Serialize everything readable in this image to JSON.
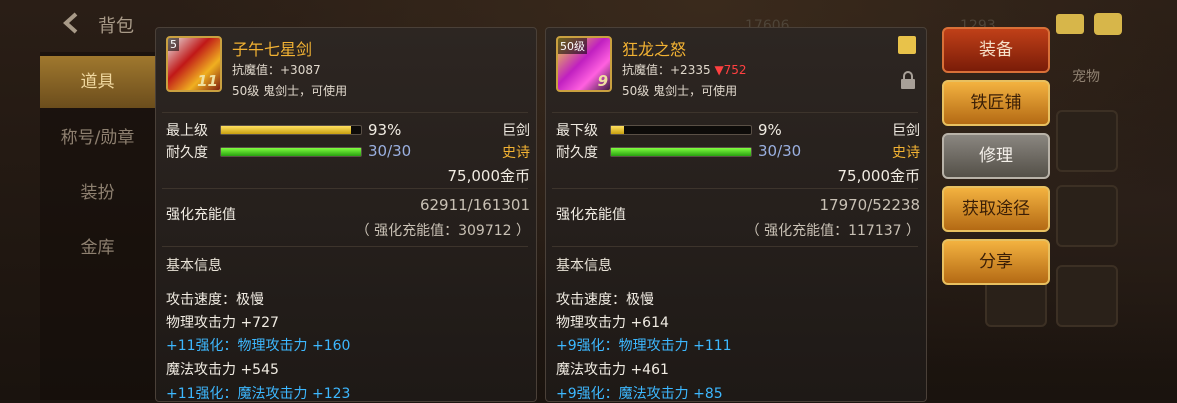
{
  "header": {
    "title": "背包",
    "faded_a": "17606",
    "faded_b": "1293"
  },
  "sidebar": {
    "items": [
      {
        "label": "道具"
      },
      {
        "label": "称号/勋章"
      },
      {
        "label": "装扮"
      },
      {
        "label": "金库"
      }
    ]
  },
  "inventory": {
    "label": "宠物"
  },
  "left_item": {
    "level_badge": "5",
    "enhance_badge": "11",
    "name": "子午七星剑",
    "anti_magic": "抗魔值：+3087",
    "usable": "50级 鬼剑士，可使用",
    "grade_label": "最上级",
    "grade_pct": "93%",
    "grade_fill": 93,
    "durability_label": "耐久度",
    "durability_value": "30/30",
    "durability_fill": 100,
    "weapon_type": "巨剑",
    "rarity": "史诗",
    "price": "75,000金币",
    "enhance_label": "强化充能值",
    "enhance_value": "62911/161301",
    "enhance_total": "（ 强化充能值：309712 ）",
    "section": "基本信息",
    "stats": [
      {
        "text": "攻击速度：极慢",
        "blue": false
      },
      {
        "text": "物理攻击力 +727",
        "blue": false
      },
      {
        "text": "+11强化：物理攻击力 +160",
        "blue": true
      },
      {
        "text": "魔法攻击力 +545",
        "blue": false
      },
      {
        "text": "+11强化：魔法攻击力 +123",
        "blue": true
      }
    ]
  },
  "right_item": {
    "level_badge": "50级",
    "enhance_badge": "9",
    "name": "狂龙之怒",
    "anti_magic": "抗魔值：+2335",
    "anti_magic_diff": "▼752",
    "usable": "50级 鬼剑士，可使用",
    "grade_label": "最下级",
    "grade_pct": "9%",
    "grade_fill": 9,
    "durability_label": "耐久度",
    "durability_value": "30/30",
    "durability_fill": 100,
    "weapon_type": "巨剑",
    "rarity": "史诗",
    "price": "75,000金币",
    "enhance_label": "强化充能值",
    "enhance_value": "17970/52238",
    "enhance_total": "（ 强化充能值：117137 ）",
    "section": "基本信息",
    "stats": [
      {
        "text": "攻击速度：极慢",
        "blue": false
      },
      {
        "text": "物理攻击力 +614",
        "blue": false
      },
      {
        "text": "+9强化：物理攻击力 +111",
        "blue": true
      },
      {
        "text": "魔法攻击力 +461",
        "blue": false
      },
      {
        "text": "+9强化：魔法攻击力 +85",
        "blue": true
      }
    ]
  },
  "actions": {
    "equip": "装备",
    "smith": "铁匠铺",
    "repair": "修理",
    "acquire": "获取途径",
    "share": "分享"
  }
}
